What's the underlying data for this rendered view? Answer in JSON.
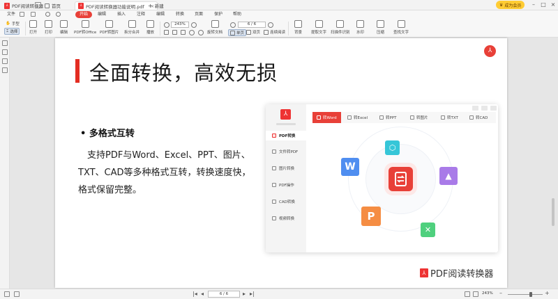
{
  "titlebar": {
    "app_title": "PDF阅读转换器",
    "tabs": [
      {
        "label": "首页"
      },
      {
        "label": "PDF阅读转换器功能说明.pdf"
      },
      {
        "label": "新建"
      }
    ],
    "vip_label": "成为会员"
  },
  "menubar": {
    "items": [
      "文件",
      "开始",
      "编辑",
      "插入",
      "注释",
      "编辑",
      "转换",
      "页面",
      "保护",
      "帮助"
    ],
    "active": "开始"
  },
  "toolbar": {
    "hand": "手型",
    "select": "选择",
    "open": "打开",
    "print": "打印",
    "edit": "编辑",
    "pdf_to_office": "PDF转Office",
    "pdf_to_image": "PDF转图片",
    "split_merge": "拆分合并",
    "play": "播放",
    "zoom": "243%",
    "page_field": "6 / 6",
    "rotate": "旋转文档",
    "single_page": "单页",
    "double_page": "双页",
    "continuous": "连续阅读",
    "background": "背景",
    "extract_text": "提取文字",
    "scan_recognize": "扫描件识别",
    "watermark": "水印",
    "compress": "压缩",
    "find_text": "查找文字"
  },
  "slide": {
    "title": "全面转换，高效无损",
    "bullet": "• 多格式互转",
    "body": "支持PDF与Word、Excel、PPT、图片、TXT、CAD等多种格式互转，转换速度快，格式保留完整。",
    "brand": "PDF阅读转换器"
  },
  "app": {
    "side_items": [
      "PDF转换",
      "文件转PDF",
      "图片转换",
      "PDF操作",
      "CAD转换",
      "视频转换"
    ],
    "tabs": [
      "转Word",
      "转Excel",
      "转PPT",
      "转图片",
      "转TXT",
      "转CAD"
    ],
    "icons": {
      "word": "W",
      "ppt": "P",
      "excel": "✕"
    }
  },
  "statusbar": {
    "page": "6 / 6",
    "zoom": "243%"
  },
  "colors": {
    "accent": "#e84038",
    "word": "#4f8ef0",
    "ppt": "#f58d43",
    "excel": "#4fd07e",
    "image": "#a97be8",
    "cube": "#36c6d8"
  },
  "icon_names": [
    "pdf-logo-icon",
    "home-icon",
    "save-icon",
    "print-icon",
    "undo-icon",
    "redo-icon",
    "hand-icon",
    "select-icon",
    "open-icon",
    "rotate-icon",
    "zoom-in-icon",
    "zoom-out-icon",
    "search-icon"
  ]
}
